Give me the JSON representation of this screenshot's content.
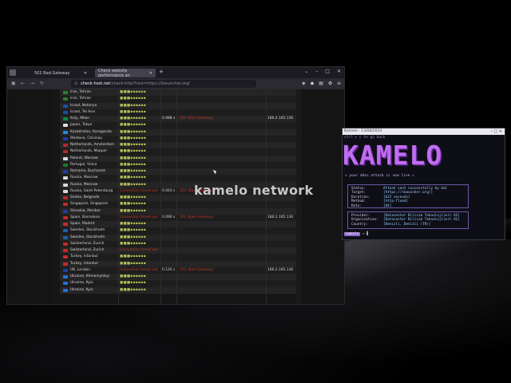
{
  "browser": {
    "tabs": [
      {
        "label": "502 Bad Gateway"
      },
      {
        "label": "Check website performance an"
      }
    ],
    "url_host": "check-host.net",
    "url_path": "/check-http?host=https://lbauncher.org/"
  },
  "table": {
    "rows": [
      {
        "flag": "#2e7d32",
        "location": "Iran, Tehran",
        "dots": "■■■▪▪▪▪▪▪",
        "time": "",
        "result": "",
        "ip": ""
      },
      {
        "flag": "#2e7d32",
        "location": "Iran, Tehran",
        "dots": "■■■▪▪▪▪▪▪",
        "time": "",
        "result": "",
        "ip": ""
      },
      {
        "flag": "#1e4fa0",
        "location": "Israel, Netanya",
        "dots": "■■■▪▪▪▪▪▪",
        "time": "",
        "result": "",
        "ip": ""
      },
      {
        "flag": "#1e4fa0",
        "location": "Israel, Tel Aviv",
        "dots": "■■■▪▪▪▪▪▪",
        "time": "",
        "result": "",
        "ip": ""
      },
      {
        "flag": "#0f8a3c",
        "location": "Italy, Milan",
        "dots": "■■■▪▪▪▪▪▪",
        "time": "0.088 s",
        "result": "502 (Bad Gateway)",
        "ip": "186.2.165.136"
      },
      {
        "flag": "#e0e0e0",
        "location": "Japan, Tokyo",
        "dots": "■■■▪▪▪▪▪▪",
        "time": "",
        "result": "",
        "ip": ""
      },
      {
        "flag": "#2a8ad6",
        "location": "Kazakhstan, Karaganda",
        "dots": "■■■▪▪▪▪▪▪",
        "time": "",
        "result": "",
        "ip": ""
      },
      {
        "flag": "#1e3fa0",
        "location": "Moldova, Chisinau",
        "dots": "■■■▪▪▪▪▪▪",
        "time": "",
        "result": "",
        "ip": ""
      },
      {
        "flag": "#b22a2a",
        "location": "Netherlands, Amsterdam",
        "dots": "■■■▪▪▪▪▪▪",
        "time": "",
        "result": "",
        "ip": ""
      },
      {
        "flag": "#b22a2a",
        "location": "Netherlands, Meppel",
        "dots": "■■■▪▪▪▪▪▪",
        "time": "",
        "result": "",
        "ip": ""
      },
      {
        "flag": "#d9d9d9",
        "location": "Poland, Warsaw",
        "dots": "■■■▪▪▪▪▪▪",
        "time": "",
        "result": "",
        "ip": ""
      },
      {
        "flag": "#1b7a2e",
        "location": "Portugal, Viana",
        "dots": "■■■▪▪▪▪▪▪",
        "time": "",
        "result": "",
        "ip": ""
      },
      {
        "flag": "#1e3fa0",
        "location": "Romania, Bucharest",
        "dots": "■■■▪▪▪▪▪▪",
        "time": "",
        "result": "",
        "ip": ""
      },
      {
        "flag": "#d9d9d9",
        "location": "Russia, Moscow",
        "dots": "■■■▪▪▪▪▪▪",
        "time": "",
        "result": "",
        "ip": ""
      },
      {
        "flag": "#d9d9d9",
        "location": "Russia, Moscow",
        "dots": "■■■▪▪▪▪▪▪",
        "time": "",
        "result": "",
        "ip": ""
      },
      {
        "flag": "#d9d9d9",
        "location": "Russia, Saint Petersburg",
        "dots": "",
        "error": "Connection timed out",
        "time": "0.043 s",
        "result": "502 (Bad Gateway)",
        "ip": ""
      },
      {
        "flag": "#b22a2a",
        "location": "Serbia, Belgrade",
        "dots": "■■■▪▪▪▪▪▪",
        "time": "",
        "result": "",
        "ip": ""
      },
      {
        "flag": "#c62828",
        "location": "Singapore, Singapore",
        "dots": "■■■▪▪▪▪▪▪",
        "time": "",
        "result": "",
        "ip": ""
      },
      {
        "flag": "#1e3fa0",
        "location": "Slovakia, Maribor",
        "dots": "■■■▪▪▪▪▪▪",
        "time": "",
        "result": "",
        "ip": ""
      },
      {
        "flag": "#c62828",
        "location": "Spain, Barcelona",
        "dots": "",
        "error": "Connection timed out",
        "time": "0.090 s",
        "result": "502 (Bad Gateway)",
        "ip": "186.2.165.136"
      },
      {
        "flag": "#c62828",
        "location": "Spain, Madrid",
        "dots": "■■■▪▪▪▪▪▪",
        "time": "",
        "result": "",
        "ip": ""
      },
      {
        "flag": "#1e5fa0",
        "location": "Sweden, Stockholm",
        "dots": "■■■▪▪▪▪▪▪",
        "time": "",
        "result": "",
        "ip": ""
      },
      {
        "flag": "#1e5fa0",
        "location": "Sweden, Stockholm",
        "dots": "■■■▪▪▪▪▪▪",
        "time": "",
        "result": "",
        "ip": ""
      },
      {
        "flag": "#c62828",
        "location": "Switzerland, Zurich",
        "dots": "■■■▪▪▪▪▪▪",
        "time": "",
        "result": "",
        "ip": ""
      },
      {
        "flag": "#c62828",
        "location": "Switzerland, Zurich",
        "dots": "",
        "error": "Connection timed out",
        "time": "",
        "result": "",
        "ip": ""
      },
      {
        "flag": "#c62828",
        "location": "Turkey, Istanbul",
        "dots": "■■■▪▪▪▪▪▪",
        "time": "",
        "result": "",
        "ip": ""
      },
      {
        "flag": "#c62828",
        "location": "Turkey, Istanbul",
        "dots": "■■■▪▪▪▪▪▪",
        "time": "",
        "result": "",
        "ip": ""
      },
      {
        "flag": "#1e3fa0",
        "location": "UK, London",
        "dots": "",
        "error": "Connection timed out",
        "time": "0.120 s",
        "result": "502 (Bad Gateway)",
        "ip": "186.2.165.136"
      },
      {
        "flag": "#2a6fd6",
        "location": "Ukraine, Khmelnytskyi",
        "dots": "■■■▪▪▪▪▪▪",
        "time": "",
        "result": "",
        "ip": ""
      },
      {
        "flag": "#2a6fd6",
        "location": "Ukraine, Kyiv",
        "dots": "■■■▪▪▪▪▪▪",
        "time": "",
        "result": "",
        "ip": ""
      },
      {
        "flag": "#2a6fd6",
        "location": "Ukraine, Kyiv",
        "dots": "■■■▪▪▪▪▪▪",
        "time": "",
        "result": "",
        "ip": ""
      }
    ]
  },
  "terminal": {
    "title": "Kamelo - 13/08/2024",
    "hint": "ctrl + c to go back",
    "banner": "KAMELO",
    "subline": "» your ddos attack is now live «",
    "info": [
      {
        "k": "Status:",
        "v": "Attack sent successfully by kml"
      },
      {
        "k": "Target:",
        "v": "[https://lbauncher.org/]"
      },
      {
        "k": "Duration:",
        "v": "[615 seconds]"
      },
      {
        "k": "Method:",
        "v": "[http-flood]"
      },
      {
        "k": "Rate:",
        "v": "[64]"
      }
    ],
    "info2": [
      {
        "k": "Provider:",
        "v": "[Datacenter Bilisim Teknolojileri AS]"
      },
      {
        "k": "Organization:",
        "v": "[Datacenter Bilisim Teknolojileri AS]"
      },
      {
        "k": "Country:",
        "v": "[Denizli, Denizli (TR)]"
      }
    ],
    "prompt_tag": "kamelo",
    "prompt_text": "» ▌"
  },
  "watermark": "kamelo network"
}
